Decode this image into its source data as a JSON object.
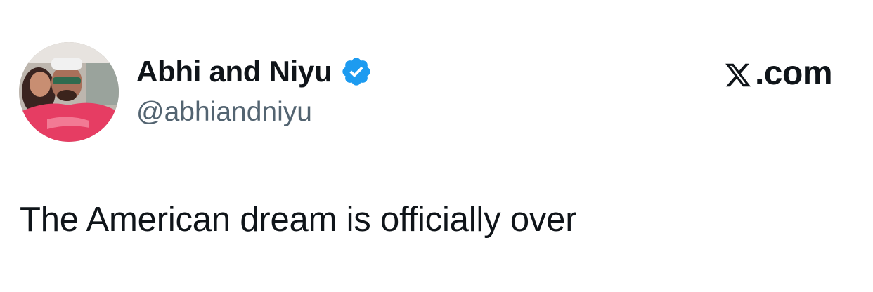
{
  "tweet": {
    "display_name": "Abhi and Niyu",
    "handle": "@abhiandniyu",
    "verified": true,
    "text": "The American dream is officially over"
  },
  "brand": {
    "label": ".com",
    "icon": "x-logo-icon"
  },
  "icons": {
    "verified": "verified-badge-icon",
    "avatar": "avatar-image"
  },
  "colors": {
    "verified_blue": "#1d9bf0",
    "text_primary": "#0f1419",
    "text_secondary": "#536471"
  }
}
